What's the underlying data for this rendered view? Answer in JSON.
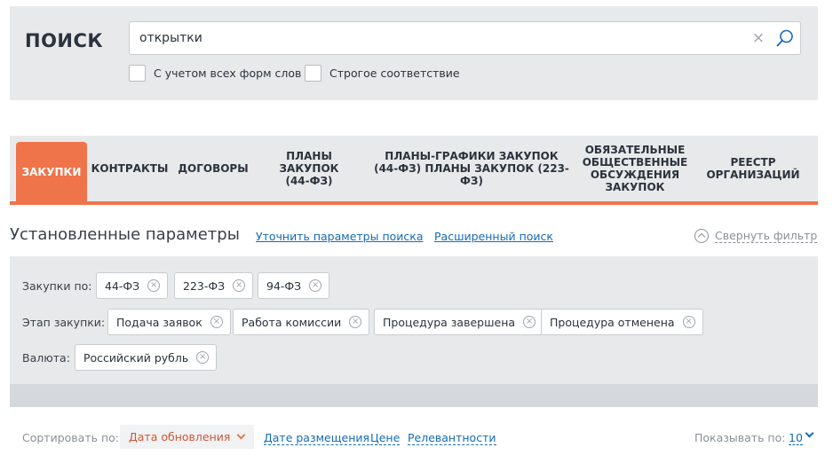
{
  "search": {
    "title": "ПОИСК",
    "value": "открытки",
    "clear_icon": "close-icon",
    "search_icon": "magnifier-icon",
    "options": [
      {
        "label": "С учетом всех форм слов",
        "checked": false
      },
      {
        "label": "Строгое соответствие",
        "checked": false
      }
    ]
  },
  "tabs": [
    {
      "label": "ЗАКУПКИ",
      "active": true
    },
    {
      "label": "КОНТРАКТЫ"
    },
    {
      "label": "ДОГОВОРЫ"
    },
    {
      "label": "ПЛАНЫ ЗАКУПОК (44-ФЗ)"
    },
    {
      "label": "ПЛАНЫ-ГРАФИКИ ЗАКУПОК (44-ФЗ) ПЛАНЫ ЗАКУПОК (223-ФЗ)"
    },
    {
      "label": "ОБЯЗАТЕЛЬНЫЕ ОБЩЕСТВЕННЫЕ ОБСУЖДЕНИЯ ЗАКУПОК"
    },
    {
      "label": "РЕЕСТР ОРГАНИЗАЦИЙ"
    }
  ],
  "params": {
    "title": "Установленные параметры",
    "refine_link": "Уточнить параметры поиска",
    "advanced_link": "Расширенный поиск",
    "collapse_label": "Свернуть фильтр"
  },
  "filters": {
    "purchases_label": "Закупки по:",
    "purchases": [
      "44-ФЗ",
      "223-ФЗ",
      "94-ФЗ"
    ],
    "stage_label": "Этап закупки:",
    "stages": [
      "Подача заявок",
      "Работа комиссии",
      "Процедура завершена",
      "Процедура отменена"
    ],
    "currency_label": "Валюта:",
    "currencies": [
      "Российский рубль"
    ],
    "remove_glyph": "×"
  },
  "sort": {
    "label": "Сортировать по:",
    "selected": "Дата обновления",
    "options": [
      "Дате размещения",
      "Цене",
      "Релевантности"
    ],
    "show_label": "Показывать по:",
    "show_value": "10"
  },
  "colors": {
    "accent": "#f0744a",
    "link": "#146bb5",
    "panel": "#e8e9eb"
  }
}
